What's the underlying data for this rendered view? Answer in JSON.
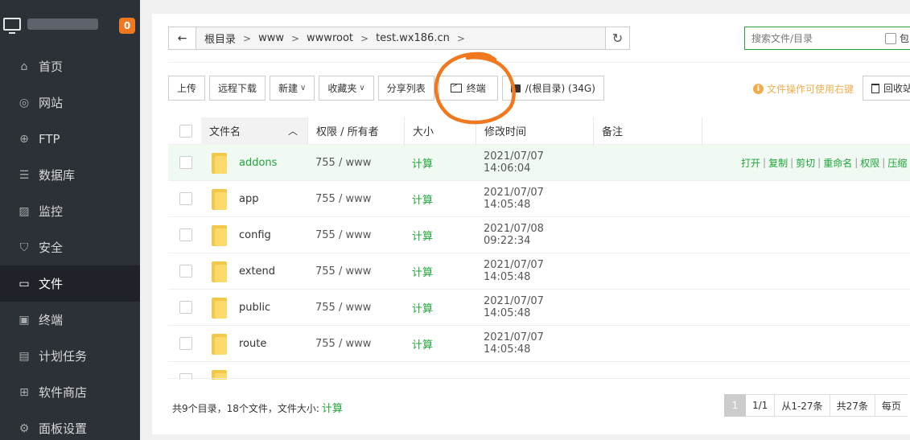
{
  "sidebar": {
    "badge": "0",
    "items": [
      {
        "label": "首页",
        "icon": "home-icon"
      },
      {
        "label": "网站",
        "icon": "globe-icon"
      },
      {
        "label": "FTP",
        "icon": "ftp-icon"
      },
      {
        "label": "数据库",
        "icon": "database-icon"
      },
      {
        "label": "监控",
        "icon": "monitor-chart-icon"
      },
      {
        "label": "安全",
        "icon": "shield-icon"
      },
      {
        "label": "文件",
        "icon": "folder-icon",
        "active": true
      },
      {
        "label": "终端",
        "icon": "terminal-icon"
      },
      {
        "label": "计划任务",
        "icon": "calendar-icon"
      },
      {
        "label": "软件商店",
        "icon": "grid-icon"
      },
      {
        "label": "面板设置",
        "icon": "gear-icon"
      }
    ]
  },
  "path": {
    "crumbs": [
      "根目录",
      "www",
      "wwwroot",
      "test.wx186.cn"
    ]
  },
  "search": {
    "placeholder": "搜索文件/目录",
    "checkbox_label": "包"
  },
  "toolbar": {
    "upload": "上传",
    "remote_download": "远程下载",
    "new": "新建",
    "favorites": "收藏夹",
    "share_list": "分享列表",
    "terminal": "终端",
    "disk": "/(根目录) (34G)"
  },
  "tip": "文件操作可使用右键",
  "recycle": "回收站",
  "table": {
    "headers": {
      "name": "文件名",
      "perm": "权限 / 所有者",
      "size": "大小",
      "mtime": "修改时间",
      "note": "备注"
    },
    "rows": [
      {
        "name": "addons",
        "perm": "755 / www",
        "size": "计算",
        "mtime": "2021/07/07 14:06:04"
      },
      {
        "name": "app",
        "perm": "755 / www",
        "size": "计算",
        "mtime": "2021/07/07 14:05:48"
      },
      {
        "name": "config",
        "perm": "755 / www",
        "size": "计算",
        "mtime": "2021/07/08 09:22:34"
      },
      {
        "name": "extend",
        "perm": "755 / www",
        "size": "计算",
        "mtime": "2021/07/07 14:05:48"
      },
      {
        "name": "public",
        "perm": "755 / www",
        "size": "计算",
        "mtime": "2021/07/07 14:05:48"
      },
      {
        "name": "route",
        "perm": "755 / www",
        "size": "计算",
        "mtime": "2021/07/07 14:05:48"
      }
    ],
    "row_actions": [
      "打开",
      "复制",
      "剪切",
      "重命名",
      "权限",
      "压缩"
    ]
  },
  "footer": {
    "summary": "共9个目录，18个文件，文件大小:",
    "calc": "计算",
    "page_current": "1",
    "page_total": "1/1",
    "range": "从1-27条",
    "count": "共27条",
    "per_page": "每页"
  },
  "annotation_color": "#f0781e"
}
